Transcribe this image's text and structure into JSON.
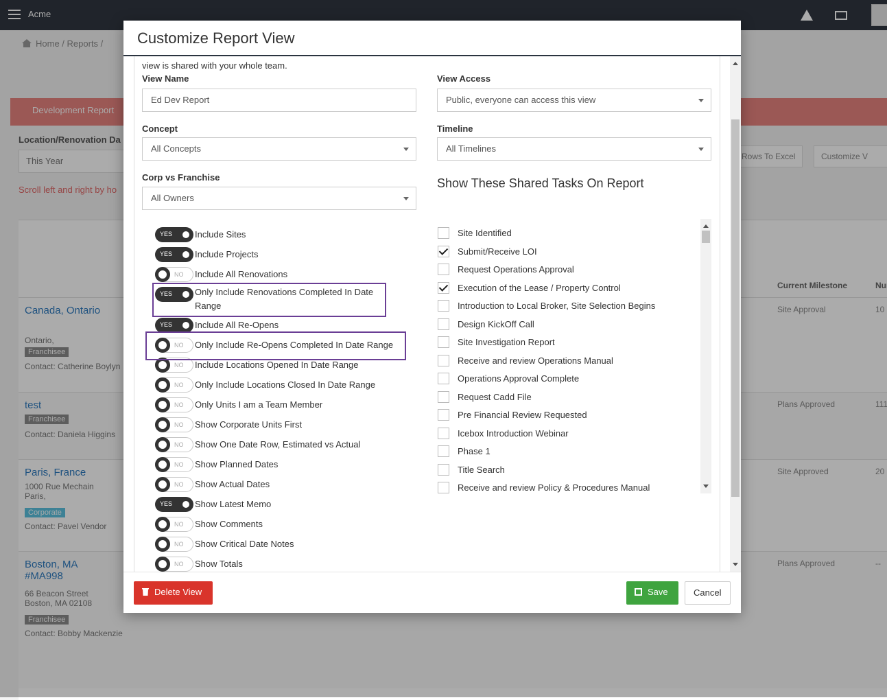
{
  "app": {
    "title": "Acme"
  },
  "breadcrumb": {
    "home": "Home",
    "reports": "Reports"
  },
  "background": {
    "panel_title": "Development Report",
    "filter_label": "Location/Renovation Da",
    "filter_value": "This Year",
    "scroll_note": "Scroll left and right by ho",
    "export_button": "Rows To Excel",
    "customize_button": "Customize V",
    "columns": {
      "milestone": "Current Milestone",
      "num": "Nur"
    },
    "rows": [
      {
        "name": "Canada, Ontario",
        "sub": "Ontario,",
        "tag": "Franchisee",
        "contact": "Contact: Catherine Boylyn",
        "milestone": "Site Approval",
        "num": "10"
      },
      {
        "name": "test",
        "sub": "",
        "tag": "Franchisee",
        "contact": "Contact: Daniela Higgins",
        "milestone": "Plans Approved",
        "num": "111"
      },
      {
        "name": "Paris, France",
        "sub": "1000 Rue Mechain Paris,",
        "tag": "Corporate",
        "contact": "Contact: Pavel Vendor",
        "milestone": "Site Approved",
        "num": "20"
      },
      {
        "name": "Boston, MA #MA998",
        "sub": "66 Beacon Street Boston, MA 02108",
        "tag": "Franchisee",
        "contact": "Contact: Bobby Mackenzie",
        "milestone": "Plans Approved",
        "num": "--"
      }
    ]
  },
  "modal": {
    "title": "Customize Report View",
    "intro": "view is shared with your whole team.",
    "view_name": {
      "label": "View Name",
      "value": "Ed Dev Report"
    },
    "view_access": {
      "label": "View Access",
      "value": "Public, everyone can access this view"
    },
    "concept": {
      "label": "Concept",
      "value": "All Concepts"
    },
    "timeline": {
      "label": "Timeline",
      "value": "All Timelines"
    },
    "corp": {
      "label": "Corp vs Franchise",
      "value": "All Owners"
    },
    "on_text": "YES",
    "off_text": "NO",
    "toggles": [
      {
        "label": "Include Sites",
        "on": true
      },
      {
        "label": "Include Projects",
        "on": true
      },
      {
        "label": "Include All Renovations",
        "on": false
      },
      {
        "label": "Only Include Renovations Completed In Date Range",
        "on": true
      },
      {
        "label": "Include All Re-Opens",
        "on": true
      },
      {
        "label": "Only Include Re-Opens Completed In Date Range",
        "on": false
      },
      {
        "label": "Include Locations Opened In Date Range",
        "on": false
      },
      {
        "label": "Only Include Locations Closed In Date Range",
        "on": false
      },
      {
        "label": "Only Units I am a Team Member",
        "on": false
      },
      {
        "label": "Show Corporate Units First",
        "on": false
      },
      {
        "label": "Show One Date Row, Estimated vs Actual",
        "on": false
      },
      {
        "label": "Show Planned Dates",
        "on": false
      },
      {
        "label": "Show Actual Dates",
        "on": false
      },
      {
        "label": "Show Latest Memo",
        "on": true
      },
      {
        "label": "Show Comments",
        "on": false
      },
      {
        "label": "Show Critical Date Notes",
        "on": false
      },
      {
        "label": "Show Totals",
        "on": false
      }
    ],
    "tasks_heading": "Show These Shared Tasks On Report",
    "tasks": [
      {
        "label": "Site Identified",
        "checked": false
      },
      {
        "label": "Submit/Receive LOI",
        "checked": true
      },
      {
        "label": "Request Operations Approval",
        "checked": false
      },
      {
        "label": "Execution of the Lease / Property Control",
        "checked": true
      },
      {
        "label": "Introduction to Local Broker, Site Selection Begins",
        "checked": false
      },
      {
        "label": "Design KickOff Call",
        "checked": false
      },
      {
        "label": "Site Investigation Report",
        "checked": false
      },
      {
        "label": "Receive and review Operations Manual",
        "checked": false
      },
      {
        "label": "Operations Approval Complete",
        "checked": false
      },
      {
        "label": "Request Cadd File",
        "checked": false
      },
      {
        "label": "Pre Financial Review Requested",
        "checked": false
      },
      {
        "label": "Icebox Introduction Webinar",
        "checked": false
      },
      {
        "label": "Phase 1",
        "checked": false
      },
      {
        "label": "Title Search",
        "checked": false
      },
      {
        "label": "Receive and review Policy & Procedures Manual",
        "checked": false
      }
    ],
    "buttons": {
      "delete": "Delete View",
      "save": "Save",
      "cancel": "Cancel"
    }
  },
  "colors": {
    "danger": "#d9342b",
    "success": "#3fa43f",
    "highlight": "#6a3e95",
    "header_bar": "#303641"
  }
}
